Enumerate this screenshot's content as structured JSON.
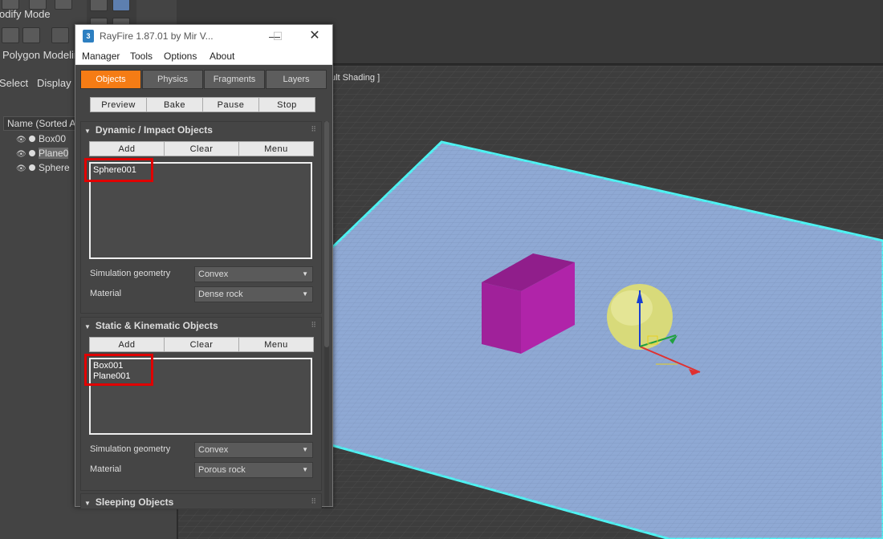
{
  "max_panel": {
    "modify_mode_label": "odify Mode",
    "polygon_modeling_label": "Polygon Modelin",
    "select_tab": "Select",
    "display_tab": "Display"
  },
  "scene_explorer": {
    "header": "Name (Sorted A",
    "rows": [
      {
        "name": "Box00"
      },
      {
        "name": "Plane0"
      },
      {
        "name": "Sphere"
      }
    ]
  },
  "viewport": {
    "label": "ult Shading ]",
    "objects": {
      "box_color": "#a0219a",
      "sphere_color": "#d8da7a",
      "plane_color": "#8fa9d4",
      "plane_edge_color": "#4ef3f3"
    }
  },
  "rayfire": {
    "logo_text": "3",
    "title": "RayFire 1.87.01   by Mir V...",
    "menu": [
      "Manager",
      "Tools",
      "Options",
      "About"
    ],
    "tabs": [
      "Objects",
      "Physics",
      "Fragments",
      "Layers"
    ],
    "active_tab": "Objects",
    "actions": [
      "Preview",
      "Bake",
      "Pause",
      "Stop"
    ],
    "dynamic": {
      "title": "Dynamic / Impact Objects",
      "buttons": [
        "Add",
        "Clear",
        "Menu"
      ],
      "items": [
        "Sphere001"
      ],
      "sim_geometry_label": "Simulation geometry",
      "sim_geometry_value": "Convex",
      "material_label": "Material",
      "material_value": "Dense rock"
    },
    "static": {
      "title": "Static & Kinematic Objects",
      "buttons": [
        "Add",
        "Clear",
        "Menu"
      ],
      "items": [
        "Box001",
        "Plane001"
      ],
      "sim_geometry_label": "Simulation geometry",
      "sim_geometry_value": "Convex",
      "material_label": "Material",
      "material_value": "Porous rock"
    },
    "sleeping": {
      "title": "Sleeping Objects"
    }
  }
}
